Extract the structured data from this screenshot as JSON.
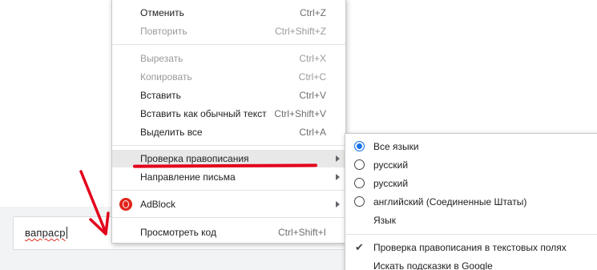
{
  "input": {
    "value": "вапраср"
  },
  "context_menu": {
    "items": [
      {
        "label": "Отменить",
        "shortcut": "Ctrl+Z",
        "disabled": false
      },
      {
        "label": "Повторить",
        "shortcut": "Ctrl+Shift+Z",
        "disabled": true
      },
      {
        "label": "Вырезать",
        "shortcut": "Ctrl+X",
        "disabled": true
      },
      {
        "label": "Копировать",
        "shortcut": "Ctrl+C",
        "disabled": true
      },
      {
        "label": "Вставить",
        "shortcut": "Ctrl+V",
        "disabled": false
      },
      {
        "label": "Вставить как обычный текст",
        "shortcut": "Ctrl+Shift+V",
        "disabled": false
      },
      {
        "label": "Выделить все",
        "shortcut": "Ctrl+A",
        "disabled": false
      },
      {
        "label": "Проверка правописания",
        "shortcut": "",
        "has_submenu": true,
        "highlighted": true
      },
      {
        "label": "Направление письма",
        "shortcut": "",
        "has_submenu": true
      },
      {
        "label": "AdBlock",
        "shortcut": "",
        "has_submenu": true,
        "icon": "adblock-icon"
      },
      {
        "label": "Просмотреть код",
        "shortcut": "Ctrl+Shift+I",
        "disabled": false
      }
    ]
  },
  "spellcheck_submenu": {
    "items": [
      {
        "label": "Все языки",
        "type": "radio",
        "selected": true
      },
      {
        "label": "русский",
        "type": "radio",
        "selected": false
      },
      {
        "label": "русский",
        "type": "radio",
        "selected": false
      },
      {
        "label": "английский (Соединенные Штаты)",
        "type": "radio",
        "selected": false
      },
      {
        "label": "Язык",
        "type": "plain"
      },
      {
        "label": "Проверка правописания в текстовых полях",
        "type": "check",
        "checked": true
      },
      {
        "label": "Искать подсказки в Google",
        "type": "plain"
      }
    ]
  },
  "colors": {
    "annotation": "#e3001b",
    "radio_selected": "#1a73e8"
  }
}
